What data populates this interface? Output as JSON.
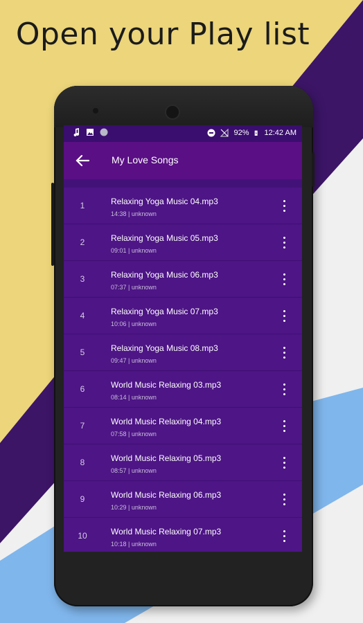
{
  "headline": "Open your Play list",
  "colors": {
    "bg_yellow": "#ecd57a",
    "bg_purple": "#3c1567",
    "bg_orange": "#c8863a",
    "bg_blue": "#7fb6ec",
    "screen_bg": "#4d1585",
    "appbar": "#5a0f85"
  },
  "status_bar": {
    "battery": "92%",
    "time": "12:42 AM"
  },
  "appbar": {
    "title": "My Love Songs"
  },
  "songs": [
    {
      "num": "1",
      "name": "Relaxing Yoga Music 04.mp3",
      "meta": "14:38 | unknown"
    },
    {
      "num": "2",
      "name": "Relaxing Yoga Music 05.mp3",
      "meta": "09:01 | unknown"
    },
    {
      "num": "3",
      "name": "Relaxing Yoga Music 06.mp3",
      "meta": "07:37 | unknown"
    },
    {
      "num": "4",
      "name": "Relaxing Yoga Music 07.mp3",
      "meta": "10:06 | unknown"
    },
    {
      "num": "5",
      "name": "Relaxing Yoga Music 08.mp3",
      "meta": "09:47 | unknown"
    },
    {
      "num": "6",
      "name": "World Music Relaxing 03.mp3",
      "meta": "08:14 | unknown"
    },
    {
      "num": "7",
      "name": "World Music Relaxing 04.mp3",
      "meta": "07:58 | unknown"
    },
    {
      "num": "8",
      "name": "World Music Relaxing 05.mp3",
      "meta": "08:57 | unknown"
    },
    {
      "num": "9",
      "name": "World Music Relaxing 06.mp3",
      "meta": "10:29 | unknown"
    },
    {
      "num": "10",
      "name": "World Music Relaxing 07.mp3",
      "meta": "10:18 | unknown"
    }
  ]
}
